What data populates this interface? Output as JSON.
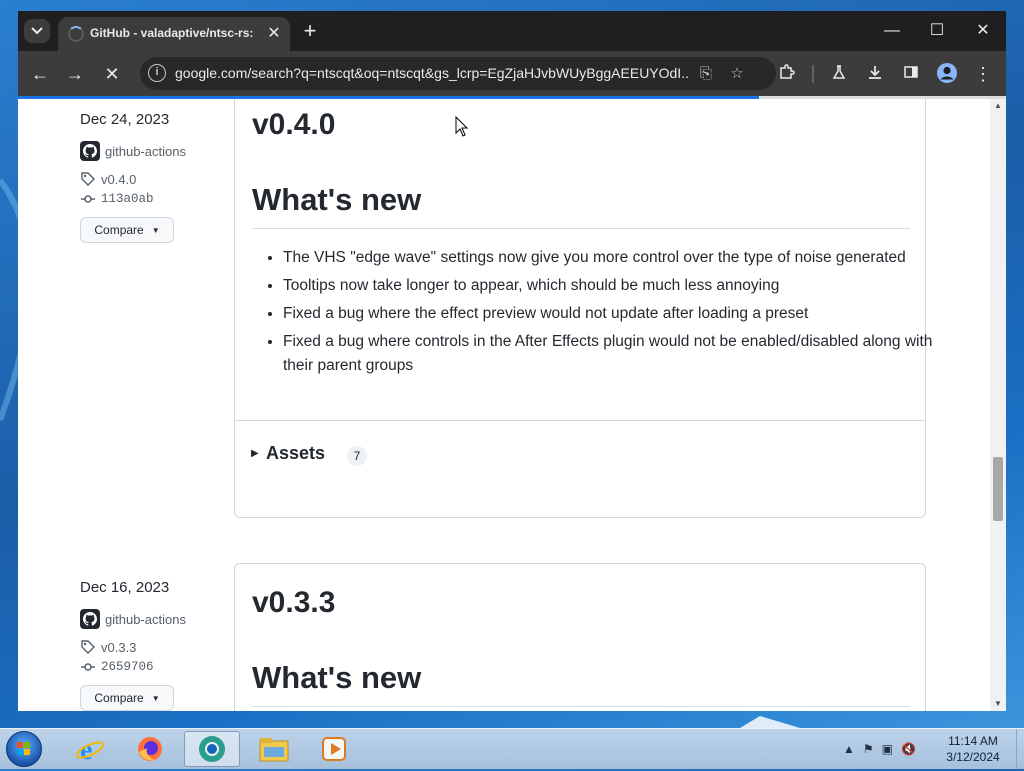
{
  "browser": {
    "tab_title": "GitHub - valadaptive/ntsc-rs: A",
    "url": "google.com/search?q=ntscqt&oq=ntscqt&gs_lcrp=EgZjaHJvbWUyBggAEEUYOdI...",
    "load_progress": 0.75
  },
  "releases": [
    {
      "date": "Dec 24, 2023",
      "author": "github-actions",
      "tag": "v0.4.0",
      "commit": "113a0ab",
      "compare_label": "Compare",
      "version": "v0.4.0",
      "whats_new": "What's new",
      "notes": [
        "The VHS \"edge wave\" settings now give you more control over the type of noise generated",
        "Tooltips now take longer to appear, which should be much less annoying",
        "Fixed a bug where the effect preview would not update after loading a preset",
        "Fixed a bug where controls in the After Effects plugin would not be enabled/disabled along with their parent groups"
      ],
      "assets_label": "Assets",
      "assets_count": "7"
    },
    {
      "date": "Dec 16, 2023",
      "author": "github-actions",
      "tag": "v0.3.3",
      "commit": "2659706",
      "compare_label": "Compare",
      "version": "v0.3.3",
      "whats_new": "What's new"
    }
  ],
  "taskbar": {
    "apps": [
      "internet-explorer-icon",
      "firefox-icon",
      "chrome-icon",
      "file-explorer-icon",
      "media-player-icon"
    ],
    "time": "11:14 AM",
    "date": "3/12/2024"
  },
  "colors": {
    "chrome_titlebar": "#1f1f1f",
    "chrome_toolbar": "#3c3c3c",
    "progress": "#1a73e8",
    "github_text": "#24292f",
    "github_muted": "#57606a",
    "border": "#d0d7de"
  }
}
